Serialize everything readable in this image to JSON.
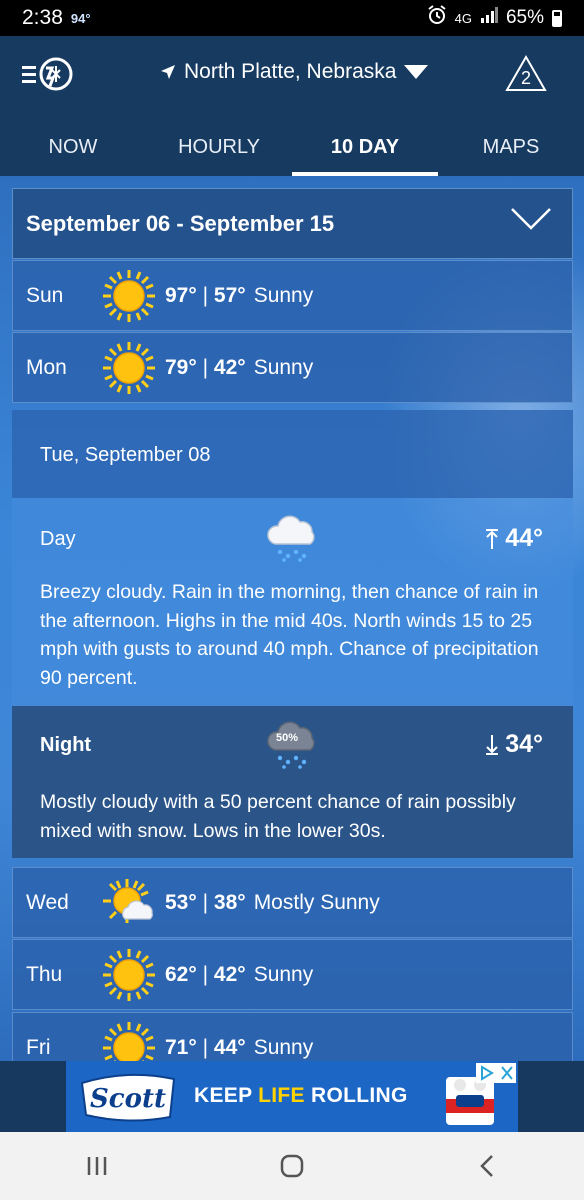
{
  "status_bar": {
    "time": "2:38",
    "temp": "94°",
    "network": "4G",
    "battery": "65%"
  },
  "header": {
    "location": "North Platte, Nebraska",
    "alert_count": "2"
  },
  "tabs": [
    {
      "label": "NOW",
      "active": false
    },
    {
      "label": "HOURLY",
      "active": false
    },
    {
      "label": "10 DAY",
      "active": true
    },
    {
      "label": "MAPS",
      "active": false
    }
  ],
  "range": {
    "title": "September 06 - September 15"
  },
  "days": [
    {
      "day": "Sun",
      "high": "97°",
      "sep": "|",
      "low": "57°",
      "condition": "Sunny",
      "icon": "sun-icon"
    },
    {
      "day": "Mon",
      "high": "79°",
      "sep": "|",
      "low": "42°",
      "condition": "Sunny",
      "icon": "sun-icon"
    },
    {
      "day": "Wed",
      "high": "53°",
      "sep": "|",
      "low": "38°",
      "condition": "Mostly Sunny",
      "icon": "mostly-sunny-icon"
    },
    {
      "day": "Thu",
      "high": "62°",
      "sep": "|",
      "low": "42°",
      "condition": "Sunny",
      "icon": "sun-icon"
    },
    {
      "day": "Fri",
      "high": "71°",
      "sep": "|",
      "low": "44°",
      "condition": "Sunny",
      "icon": "sun-icon"
    }
  ],
  "detail": {
    "title": "Tue, September 08",
    "day": {
      "label": "Day",
      "temp": "44°",
      "text": "Breezy  cloudy. Rain in the morning, then chance of rain in the afternoon. Highs in the mid 40s. North winds 15 to 25 mph with gusts to around 40 mph. Chance of precipitation 90 percent."
    },
    "night": {
      "label": "Night",
      "temp": "34°",
      "precip_badge": "50%",
      "text": "Mostly cloudy with a 50 percent chance of rain possibly mixed with snow. Lows in the lower 30s."
    }
  },
  "ad": {
    "brand": "Scott",
    "text_before": "KEEP ",
    "text_highlight": "LIFE",
    "text_after": " ROLLING",
    "colors": {
      "background": "#1c67c6",
      "highlight": "#ffd200"
    }
  },
  "colors": {
    "header_bg": "#173a61",
    "content_bg": "#3b86d8",
    "night_bg": "#2b5589"
  }
}
